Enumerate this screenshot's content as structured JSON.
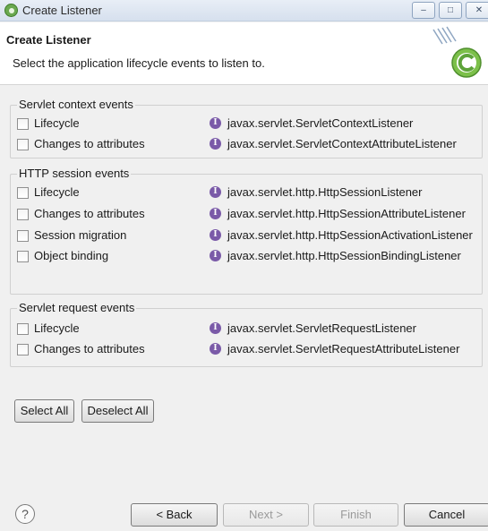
{
  "window": {
    "title": "Create Listener",
    "min_glyph": "–",
    "max_glyph": "□",
    "close_glyph": "✕"
  },
  "header": {
    "title": "Create Listener",
    "description": "Select the application lifecycle events to listen to."
  },
  "groups": {
    "context": {
      "title": "Servlet context events",
      "rows": [
        {
          "label": "Lifecycle",
          "interface": "javax.servlet.ServletContextListener",
          "checked": false
        },
        {
          "label": "Changes to attributes",
          "interface": "javax.servlet.ServletContextAttributeListener",
          "checked": false
        }
      ]
    },
    "session": {
      "title": "HTTP session events",
      "rows": [
        {
          "label": "Lifecycle",
          "interface": "javax.servlet.http.HttpSessionListener",
          "checked": false
        },
        {
          "label": "Changes to attributes",
          "interface": "javax.servlet.http.HttpSessionAttributeListener",
          "checked": false
        },
        {
          "label": "Session migration",
          "interface": "javax.servlet.http.HttpSessionActivationListener",
          "checked": false
        },
        {
          "label": "Object binding",
          "interface": "javax.servlet.http.HttpSessionBindingListener",
          "checked": false
        }
      ]
    },
    "request": {
      "title": "Servlet request events",
      "rows": [
        {
          "label": "Lifecycle",
          "interface": "javax.servlet.ServletRequestListener",
          "checked": false
        },
        {
          "label": "Changes to attributes",
          "interface": "javax.servlet.ServletRequestAttributeListener",
          "checked": false
        }
      ]
    }
  },
  "icons": {
    "interface": "interface-icon",
    "glyph": "I",
    "help": "?"
  },
  "buttons": {
    "select_all": "Select All",
    "deselect_all": "Deselect All",
    "back": "< Back",
    "next": "Next >",
    "finish": "Finish",
    "cancel": "Cancel"
  },
  "colors": {
    "interface_icon": "#7a5aa8",
    "spring_logo": "#6aa84f"
  }
}
